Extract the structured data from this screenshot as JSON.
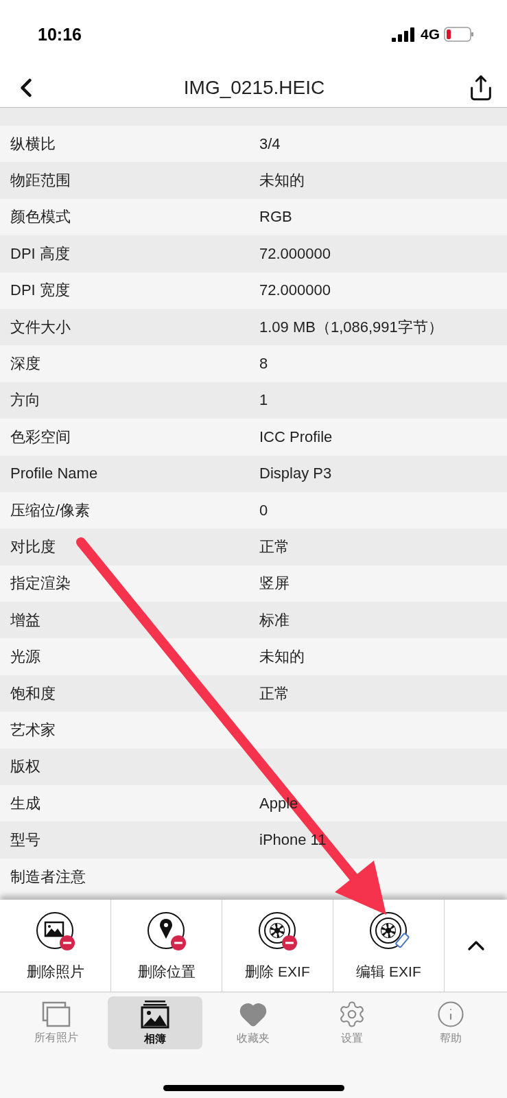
{
  "status_bar": {
    "time": "10:16",
    "network": "4G"
  },
  "nav": {
    "title": "IMG_0215.HEIC"
  },
  "rows": [
    {
      "label": "纵横比",
      "value": "3/4"
    },
    {
      "label": "物距范围",
      "value": "未知的"
    },
    {
      "label": "颜色模式",
      "value": "RGB"
    },
    {
      "label": "DPI 高度",
      "value": "72.000000"
    },
    {
      "label": "DPI 宽度",
      "value": "72.000000"
    },
    {
      "label": "文件大小",
      "value": "1.09 MB（1,086,991字节）"
    },
    {
      "label": "深度",
      "value": "8"
    },
    {
      "label": "方向",
      "value": "1"
    },
    {
      "label": "色彩空间",
      "value": "ICC Profile"
    },
    {
      "label": "Profile Name",
      "value": "Display P3"
    },
    {
      "label": "压缩位/像素",
      "value": "0"
    },
    {
      "label": "对比度",
      "value": "正常"
    },
    {
      "label": "指定渲染",
      "value": "竖屏"
    },
    {
      "label": "增益",
      "value": "标准"
    },
    {
      "label": "光源",
      "value": "未知的"
    },
    {
      "label": "饱和度",
      "value": "正常"
    },
    {
      "label": "艺术家"
    },
    {
      "label": "版权"
    },
    {
      "label": "生成",
      "value": "Apple"
    },
    {
      "label": "型号",
      "value": "iPhone 11"
    },
    {
      "label": "制造者注意"
    }
  ],
  "actions": [
    {
      "label": "删除照片",
      "kind": "delete-photo"
    },
    {
      "label": "删除位置",
      "kind": "delete-location"
    },
    {
      "label": "删除 EXIF",
      "kind": "delete-exif"
    },
    {
      "label": "编辑 EXIF",
      "kind": "edit-exif"
    }
  ],
  "tabs": [
    {
      "label": "所有照片",
      "kind": "all",
      "selected": false
    },
    {
      "label": "相簿",
      "kind": "album",
      "selected": true
    },
    {
      "label": "收藏夹",
      "kind": "favorites",
      "selected": false
    },
    {
      "label": "设置",
      "kind": "settings",
      "selected": false
    },
    {
      "label": "帮助",
      "kind": "help",
      "selected": false
    }
  ]
}
